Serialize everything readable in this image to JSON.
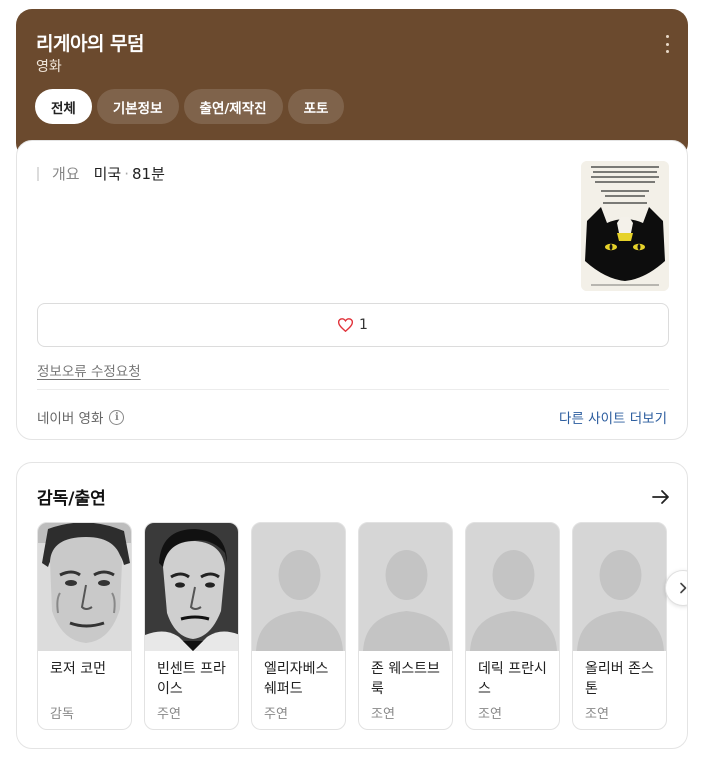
{
  "header": {
    "title": "리게아의 무덤",
    "subtitle": "영화",
    "tabs": [
      "전체",
      "기본정보",
      "출연/제작진",
      "포토"
    ],
    "accent_color": "#6b4a2e"
  },
  "overview": {
    "label": "개요",
    "country": "미국",
    "separator": "·",
    "runtime": "81분"
  },
  "poster": {
    "title_text": "TOMB LIGEIA",
    "icon": "movie-poster"
  },
  "like": {
    "icon": "heart-icon",
    "count": "1"
  },
  "error_link": "정보오류 수정요청",
  "source": {
    "label": "네이버 영화",
    "info_icon": "i"
  },
  "more_sites": "다른 사이트 더보기",
  "cast": {
    "title": "감독/출연",
    "people": [
      {
        "name": "로저 코먼",
        "role": "감독",
        "photo": "portrait"
      },
      {
        "name": "빈센트 프라이스",
        "role": "주연",
        "photo": "portrait"
      },
      {
        "name": "엘리자베스 쉐퍼드",
        "role": "주연",
        "photo": "placeholder"
      },
      {
        "name": "존 웨스트브룩",
        "role": "조연",
        "photo": "placeholder"
      },
      {
        "name": "데릭 프란시스",
        "role": "조연",
        "photo": "placeholder"
      },
      {
        "name": "올리버 존스톤",
        "role": "조연",
        "photo": "placeholder"
      }
    ]
  }
}
